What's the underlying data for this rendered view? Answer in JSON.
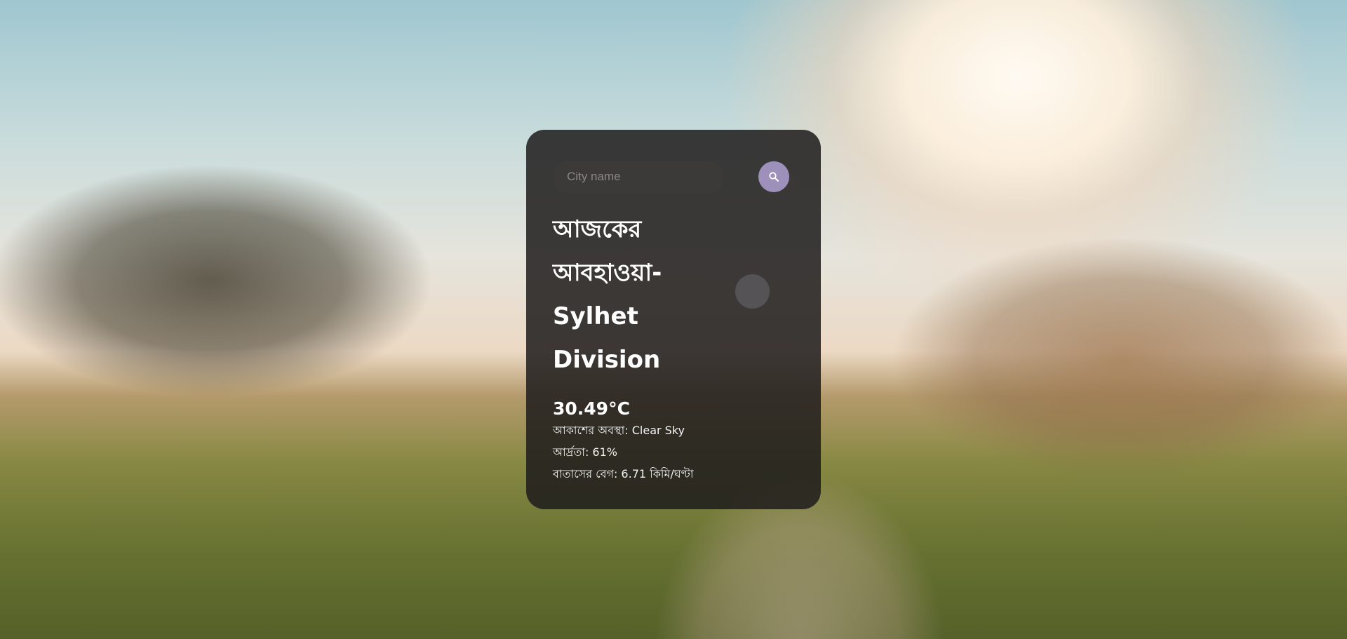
{
  "search": {
    "placeholder": "City name",
    "button_icon": "search-icon"
  },
  "weather": {
    "title": "আজকের আবহাওয়া- Sylhet Division",
    "temperature": "30.49°C",
    "condition": "আকাশের অবস্থা: Clear Sky",
    "humidity": "আর্দ্রতা: 61%",
    "wind": "বাতাসের বেগ: 6.71 কিমি/ঘণ্টা",
    "icon": "weather-icon"
  },
  "colors": {
    "card_background": "#1e1c1c",
    "search_input_background": "#3c3a39",
    "search_button": "#9d90bb",
    "text": "#ffffff"
  }
}
